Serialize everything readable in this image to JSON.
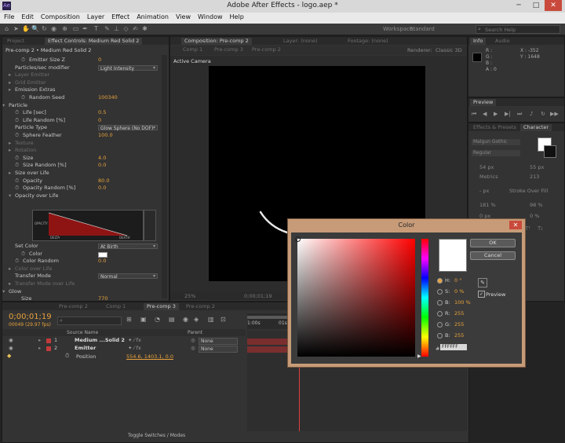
{
  "window": {
    "title": "Adobe After Effects - logo.aep *",
    "minimize": "─",
    "maximize": "□",
    "close": "✕"
  },
  "menu": [
    "File",
    "Edit",
    "Composition",
    "Layer",
    "Effect",
    "Animation",
    "View",
    "Window",
    "Help"
  ],
  "toolbar": {
    "workspace_label": "Workspace:",
    "workspace_value": "Standard",
    "search_placeholder": "Search Help"
  },
  "effect_controls": {
    "tabs": [
      "Project",
      "Effect Controls: Medium Red Solid 2"
    ],
    "breadcrumb": "Pre-comp 2 • Medium Red Solid 2",
    "rows": [
      {
        "label": "Emitter Size Z",
        "value": "0",
        "indent": 2,
        "dim": false,
        "stopwatch": true
      },
      {
        "label": "Particles/sec modifier",
        "value": "",
        "dropdown": "Light Intensity",
        "indent": 1,
        "dim": false
      },
      {
        "label": "Layer Emitter",
        "value": "",
        "indent": 1,
        "dim": true
      },
      {
        "label": "Grid Emitter",
        "value": "",
        "indent": 1,
        "dim": true
      },
      {
        "label": "Emission Extras",
        "value": "",
        "indent": 1,
        "dim": false
      },
      {
        "label": "Random Seed",
        "value": "100340",
        "indent": 2,
        "dim": false,
        "stopwatch": true
      },
      {
        "label": "Particle",
        "value": "",
        "indent": 0,
        "dim": false,
        "open": true
      },
      {
        "label": "Life [sec]",
        "value": "0.5",
        "indent": 1,
        "dim": false,
        "stopwatch": true
      },
      {
        "label": "Life Random [%]",
        "value": "0",
        "indent": 1,
        "dim": false,
        "stopwatch": true
      },
      {
        "label": "Particle Type",
        "value": "",
        "dropdown": "Glow Sphere (No DOF)",
        "indent": 1,
        "dim": false
      },
      {
        "label": "Sphere Feather",
        "value": "100.0",
        "indent": 1,
        "dim": false,
        "stopwatch": true
      },
      {
        "label": "Texture",
        "value": "",
        "indent": 1,
        "dim": true
      },
      {
        "label": "Rotation",
        "value": "",
        "indent": 1,
        "dim": true
      },
      {
        "label": "Size",
        "value": "4.0",
        "indent": 1,
        "dim": false,
        "stopwatch": true
      },
      {
        "label": "Size Random [%]",
        "value": "0.0",
        "indent": 1,
        "dim": false,
        "stopwatch": true
      },
      {
        "label": "Size over Life",
        "value": "",
        "indent": 1,
        "dim": false
      },
      {
        "label": "Opacity",
        "value": "80.0",
        "indent": 1,
        "dim": false,
        "stopwatch": true
      },
      {
        "label": "Opacity Random [%]",
        "value": "0.0",
        "indent": 1,
        "dim": false,
        "stopwatch": true
      },
      {
        "label": "Opacity over Life",
        "value": "",
        "indent": 1,
        "dim": false,
        "open": true
      }
    ],
    "graph_labels": {
      "y": "OPACITY",
      "x1": "DELTA",
      "x2": "DEATH"
    },
    "rows2": [
      {
        "label": "Set Color",
        "value": "",
        "dropdown": "At Birth",
        "indent": 1,
        "dim": false
      },
      {
        "label": "Color",
        "value": "",
        "swatch": "#ffffff",
        "indent": 2,
        "dim": false,
        "stopwatch": true
      },
      {
        "label": "Color Random",
        "value": "0.0",
        "indent": 1,
        "dim": false,
        "stopwatch": true
      },
      {
        "label": "Color over Life",
        "value": "",
        "indent": 1,
        "dim": true
      },
      {
        "label": "Transfer Mode",
        "value": "",
        "dropdown": "Normal",
        "indent": 1,
        "dim": false
      },
      {
        "label": "Transfer Mode over Life",
        "value": "",
        "indent": 1,
        "dim": true
      },
      {
        "label": "Glow",
        "value": "",
        "indent": 0,
        "dim": false,
        "open": true
      },
      {
        "label": "Size",
        "value": "770",
        "indent": 2,
        "dim": false
      }
    ]
  },
  "composition": {
    "tabs": [
      "Composition: Pre-comp 2",
      "Layer: (none)",
      "Footage: (none)"
    ],
    "subtabs": [
      "Comp 1",
      "Pre-comp 3",
      "Pre-comp 2"
    ],
    "renderer_label": "Renderer:",
    "renderer_value": "Classic 3D",
    "camera": "Active Camera",
    "zoom": "25%",
    "timecode": "0;00;01;19"
  },
  "info_panel": {
    "tabs": [
      "Info",
      "Audio"
    ],
    "channels": [
      "R :",
      "G :",
      "B :",
      "A : 0"
    ],
    "coords": [
      "X : -352",
      "Y : 1648"
    ]
  },
  "preview_panel": {
    "tab": "Preview"
  },
  "character_panel": {
    "tabs": [
      "Effects & Presets",
      "Character"
    ],
    "font": "Malgun Gothic",
    "style": "Regular",
    "size": "54 px",
    "leading": "55 px",
    "tracking_label": "Metrics",
    "tracking": "213",
    "stroke": "Stroke Over Fill",
    "stroke_px": "- px",
    "vscale": "181 %",
    "hscale": "98 %",
    "baseline": "0 px",
    "tsume": "0 %"
  },
  "timeline": {
    "tabs": [
      "Pre-comp 2",
      "Comp 1",
      "Pre-comp 3",
      "Pre-comp 2"
    ],
    "timecode": "0;00;01;19",
    "frames": "00049 (29.97 fps)",
    "search_placeholder": "",
    "headers": {
      "source": "Source Name",
      "parent": "Parent"
    },
    "ruler": [
      "1:00s",
      "01s"
    ],
    "layers": [
      {
        "num": "1",
        "name": "Medium ...Solid 2",
        "color": "#c23b3b",
        "parent": "None"
      },
      {
        "num": "2",
        "name": "Emitter",
        "color": "#c23b3b",
        "parent": "None"
      }
    ],
    "position_label": "Position",
    "position_value": "554.6, 1403.1, 0.0",
    "toggle": "Toggle Switches / Modes"
  },
  "color_dialog": {
    "title": "Color",
    "ok": "OK",
    "cancel": "Cancel",
    "hsb": [
      {
        "label": "H:",
        "value": "0 °",
        "on": true
      },
      {
        "label": "S:",
        "value": "0 %",
        "on": false
      },
      {
        "label": "B:",
        "value": "100 %",
        "on": false
      }
    ],
    "rgb": [
      {
        "label": "R:",
        "value": "255"
      },
      {
        "label": "G:",
        "value": "255"
      },
      {
        "label": "B:",
        "value": "255"
      }
    ],
    "hex_label": "#",
    "hex": "FFFFFF",
    "preview_label": "Preview",
    "swatch": "#ffffff"
  }
}
